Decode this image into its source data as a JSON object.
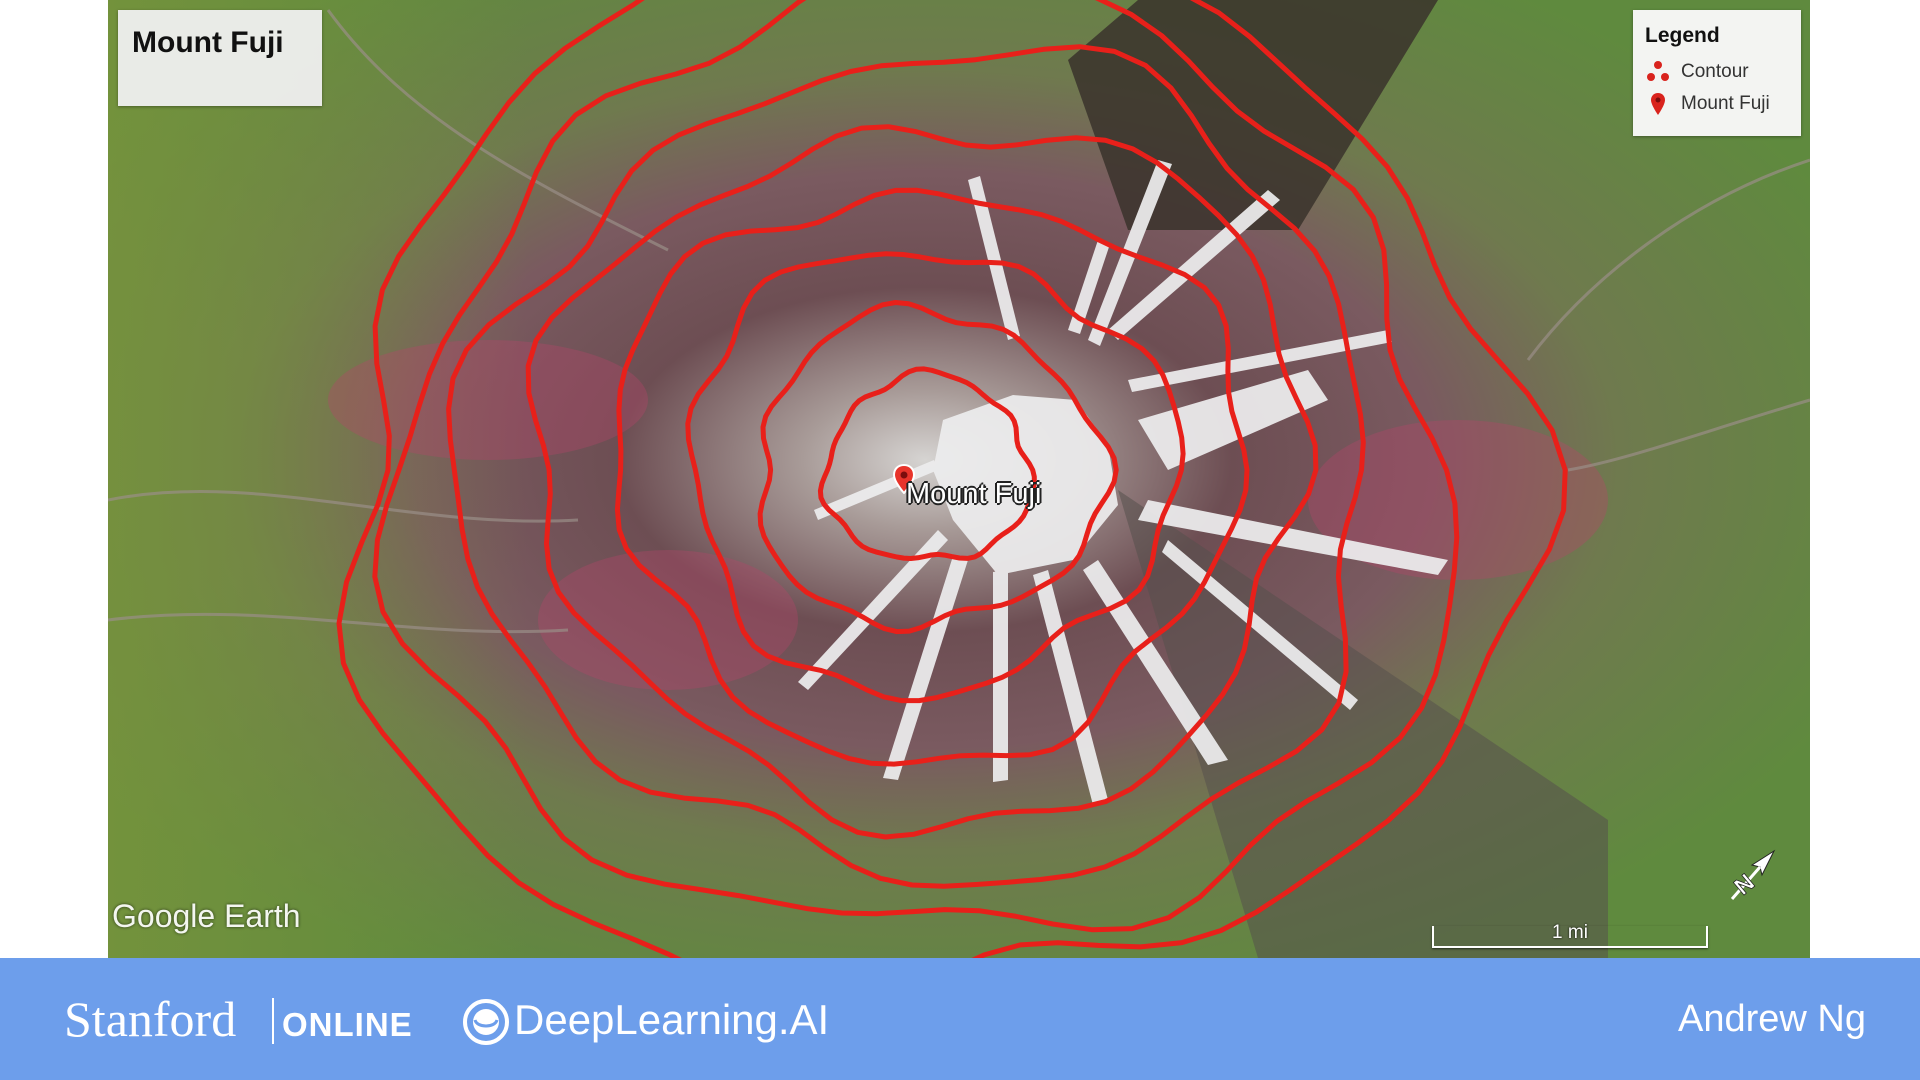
{
  "map": {
    "title": "Mount Fuji",
    "legend": {
      "title": "Legend",
      "items": [
        {
          "label": "Contour",
          "icon": "contour-icon"
        },
        {
          "label": "Mount Fuji",
          "icon": "map-pin-icon"
        }
      ]
    },
    "peak_label": "Mount Fuji",
    "watermark": "Google Earth",
    "compass": "N",
    "scale_label": "1 mi",
    "contour_color": "#e8201a",
    "contour_count": 8
  },
  "footer": {
    "stanford": "Stanford",
    "online": "ONLINE",
    "partner": "DeepLearning.AI",
    "presenter": "Andrew Ng",
    "background": "#6d9eeb"
  }
}
